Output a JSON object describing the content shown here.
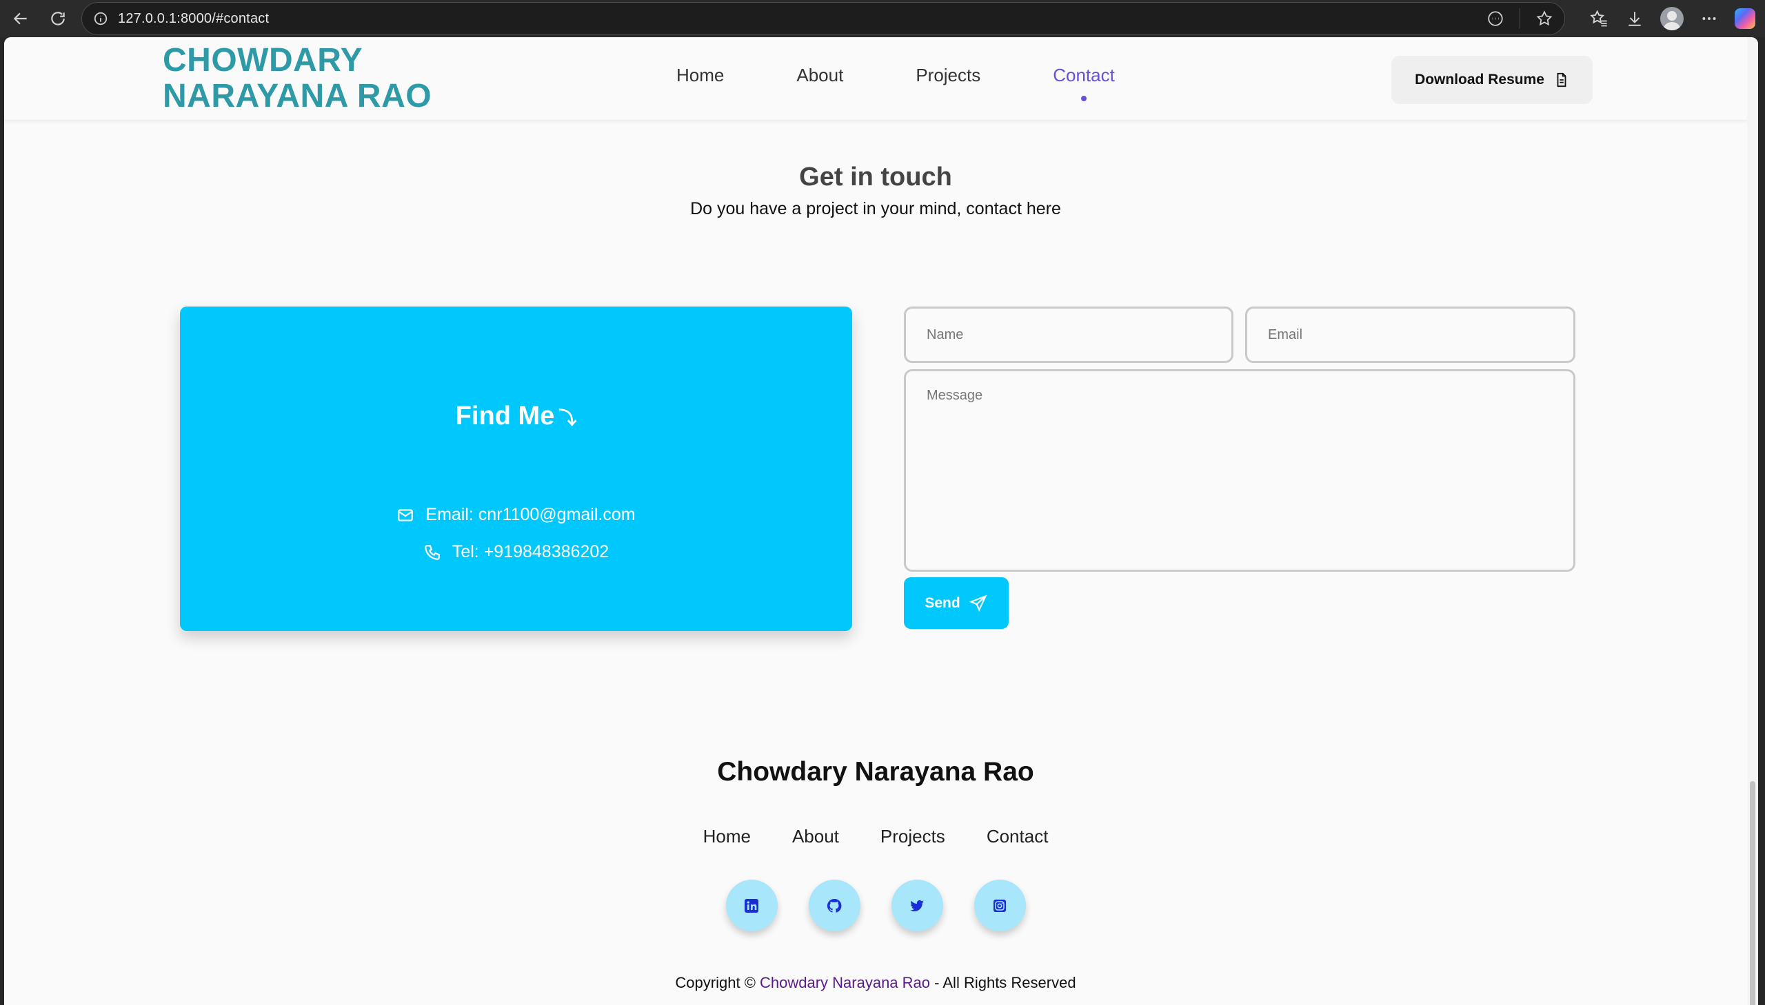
{
  "browser": {
    "url": "127.0.0.1:8000/#contact"
  },
  "header": {
    "logo_line1": "CHOWDARY",
    "logo_line2": "NARAYANA RAO",
    "nav": [
      "Home",
      "About",
      "Projects",
      "Contact"
    ],
    "active_nav": "Contact",
    "resume_label": "Download Resume"
  },
  "contact": {
    "title": "Get in touch",
    "subtitle": "Do you have a project in your mind, contact here",
    "find_title": "Find Me",
    "find_arrow": "⤵",
    "email_text": "Email: cnr1100@gmail.com",
    "tel_text": "Tel: +919848386202"
  },
  "form": {
    "name_placeholder": "Name",
    "email_placeholder": "Email",
    "message_placeholder": "Message",
    "send_label": "Send"
  },
  "footer": {
    "name": "Chowdary Narayana Rao",
    "nav": [
      "Home",
      "About",
      "Projects",
      "Contact"
    ],
    "socials": [
      "linkedin-icon",
      "github-icon",
      "twitter-icon",
      "instagram-icon"
    ],
    "copyright_prefix": "Copyright © ",
    "copyright_owner": "Chowdary Narayana Rao",
    "copyright_suffix": " - All Rights Reserved"
  },
  "colors": {
    "accent": "#00c8fc",
    "logo": "#2f9aa7",
    "active_nav": "#6a4fdc",
    "social_icon": "#1a2ed8"
  }
}
